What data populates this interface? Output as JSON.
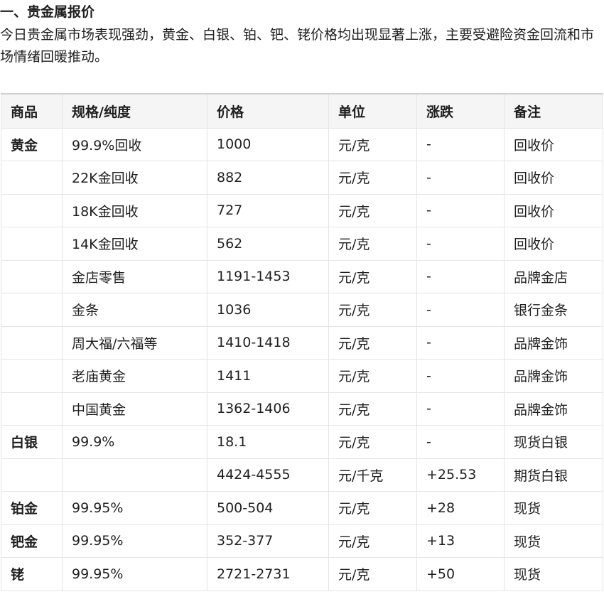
{
  "section_title": "一、贵金属报价",
  "intro": "今日贵金属市场表现强劲，黄金、白银、铂、钯、铑价格均出现显著上涨，主要受避险资金回流和市场情绪回暖推动。",
  "table": {
    "headers": [
      "商品",
      "规格/纯度",
      "价格",
      "单位",
      "涨跌",
      "备注"
    ],
    "rows": [
      [
        "黄金",
        "99.9%回收",
        "1000",
        "元/克",
        "-",
        "回收价"
      ],
      [
        "",
        "22K金回收",
        "882",
        "元/克",
        "-",
        "回收价"
      ],
      [
        "",
        "18K金回收",
        "727",
        "元/克",
        "-",
        "回收价"
      ],
      [
        "",
        "14K金回收",
        "562",
        "元/克",
        "-",
        "回收价"
      ],
      [
        "",
        "金店零售",
        "1191-1453",
        "元/克",
        "-",
        "品牌金店"
      ],
      [
        "",
        "金条",
        "1036",
        "元/克",
        "-",
        "银行金条"
      ],
      [
        "",
        "周大福/六福等",
        "1410-1418",
        "元/克",
        "-",
        "品牌金饰"
      ],
      [
        "",
        "老庙黄金",
        "1411",
        "元/克",
        "-",
        "品牌金饰"
      ],
      [
        "",
        "中国黄金",
        "1362-1406",
        "元/克",
        "-",
        "品牌金饰"
      ],
      [
        "白银",
        "99.9%",
        "18.1",
        "元/克",
        "-",
        "现货白银"
      ],
      [
        "",
        "",
        "4424-4555",
        "元/千克",
        "+25.53",
        "期货白银"
      ],
      [
        "铂金",
        "99.95%",
        "500-504",
        "元/克",
        "+28",
        "现货"
      ],
      [
        "钯金",
        "99.95%",
        "352-377",
        "元/克",
        "+13",
        "现货"
      ],
      [
        "铑",
        "99.95%",
        "2721-2731",
        "元/克",
        "+50",
        "现货"
      ]
    ]
  }
}
